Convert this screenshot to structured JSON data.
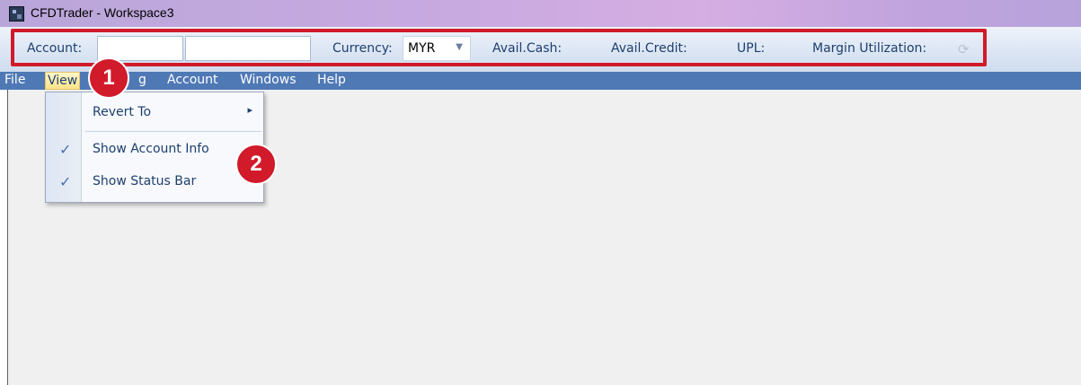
{
  "window": {
    "title": "CFDTrader - Workspace3"
  },
  "account_bar": {
    "account_label": "Account:",
    "account_field_1": "",
    "account_field_2": "",
    "currency_label": "Currency:",
    "currency_value": "MYR",
    "avail_cash_label": "Avail.Cash:",
    "avail_credit_label": "Avail.Credit:",
    "upl_label": "UPL:",
    "margin_label": "Margin Utilization:",
    "highlight_color": "#d11a2a"
  },
  "menu": {
    "items": [
      {
        "label": "File"
      },
      {
        "label": "View"
      },
      {
        "label": "g"
      },
      {
        "label": "Account"
      },
      {
        "label": "Windows"
      },
      {
        "label": "Help"
      }
    ],
    "active": "View",
    "background": "#4f79b5"
  },
  "view_menu": {
    "items": [
      {
        "label": "Revert To",
        "checked": false,
        "submenu": true
      },
      {
        "label": "Show Account Info",
        "checked": true
      },
      {
        "label": "Show Status Bar",
        "checked": true
      }
    ],
    "check_glyph": "✓",
    "submenu_glyph": "▸"
  },
  "annotations": [
    {
      "number": "1"
    },
    {
      "number": "2"
    }
  ],
  "icons": {
    "app": "cfdtrader-app-icon",
    "refresh": "refresh-icon"
  }
}
